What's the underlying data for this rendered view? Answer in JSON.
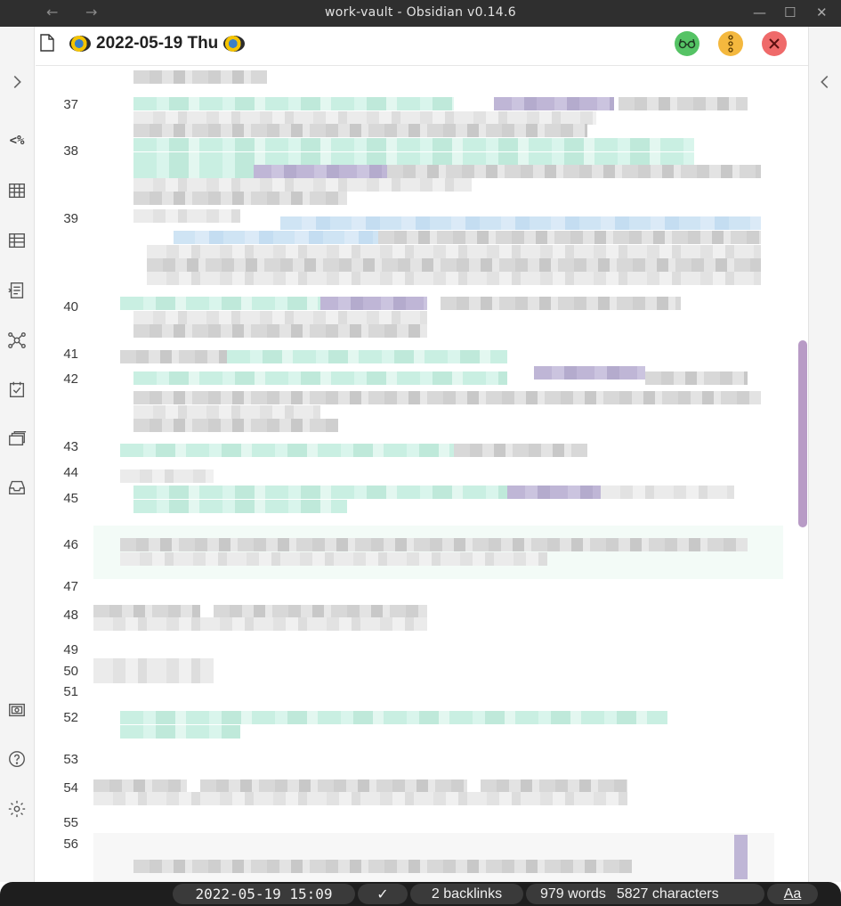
{
  "window": {
    "title": "work-vault - Obsidian v0.14.6",
    "back_glyph": "←",
    "forward_glyph": "→",
    "minimize_glyph": "—",
    "maximize_glyph": "☐",
    "close_glyph": "✕"
  },
  "note": {
    "title": "2022-05-19 Thu"
  },
  "ribbon": {
    "collapse_glyph": "›",
    "templater_label": "<%",
    "right_collapse_glyph": "‹"
  },
  "editor": {
    "line_numbers": [
      "37",
      "38",
      "39",
      "40",
      "41",
      "42",
      "43",
      "44",
      "45",
      "46",
      "47",
      "48",
      "49",
      "50",
      "51",
      "52",
      "53",
      "54",
      "55",
      "56"
    ]
  },
  "status": {
    "datetime": "2022-05-19 15:09",
    "sync_glyph": "✓",
    "backlinks": "2 backlinks",
    "words": "979 words",
    "characters": "5827 characters",
    "font_toggle": "Aa"
  },
  "colors": {
    "accent": "#b89bc6",
    "reading_button": "#55c365",
    "menu_button": "#f4b83e",
    "close_button": "#ef6a6a"
  },
  "icons": [
    "document-icon",
    "chevron-right-icon",
    "templater-icon",
    "table-icon",
    "table-alt-icon",
    "form-icon",
    "graph-icon",
    "calendar-check-icon",
    "cards-icon",
    "inbox-icon",
    "vault-icon",
    "help-icon",
    "settings-icon",
    "chevron-left-icon",
    "glasses-icon",
    "more-vertical-icon",
    "close-icon"
  ]
}
